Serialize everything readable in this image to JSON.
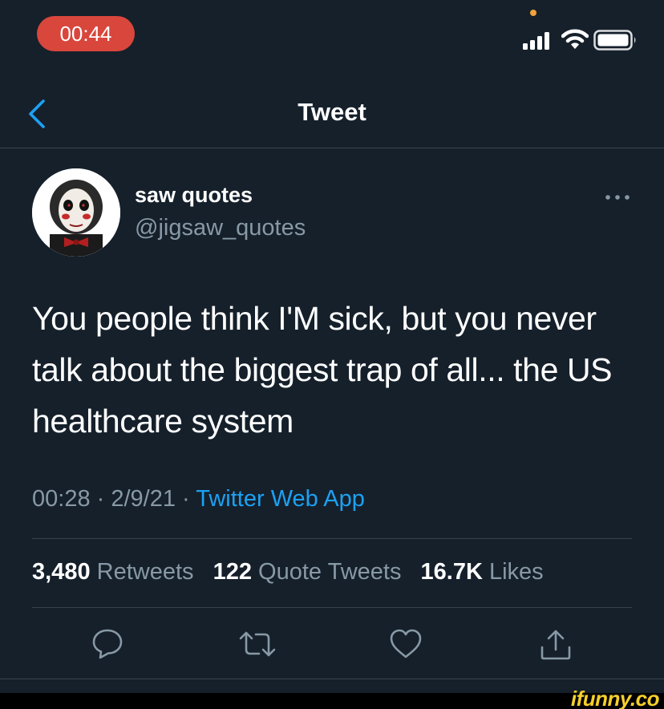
{
  "status_bar": {
    "time": "00:44"
  },
  "nav": {
    "title": "Tweet"
  },
  "tweet": {
    "display_name": "saw quotes",
    "handle": "@jigsaw_quotes",
    "text": "You people think I'M sick, but you never talk about the biggest trap of all... the US healthcare system",
    "time": "00:28",
    "date": "2/9/21",
    "separator": " · ",
    "source": "Twitter Web App"
  },
  "stats": {
    "retweets_count": "3,480",
    "retweets_label": "Retweets",
    "quotes_count": "122",
    "quotes_label": "Quote Tweets",
    "likes_count": "16.7K",
    "likes_label": "Likes"
  },
  "watermark": "ifunny.co",
  "icons": {
    "back": "chevron-left-icon",
    "more": "more-horizontal-icon",
    "reply": "reply-bubble-icon",
    "retweet": "retweet-icon",
    "like": "heart-icon",
    "share": "share-icon"
  },
  "colors": {
    "background": "#15202b",
    "accent": "#1da1f2",
    "secondary_text": "#8899a6",
    "divider": "#38444d",
    "time_pill": "#d8463c",
    "watermark": "#f5cf2c"
  }
}
